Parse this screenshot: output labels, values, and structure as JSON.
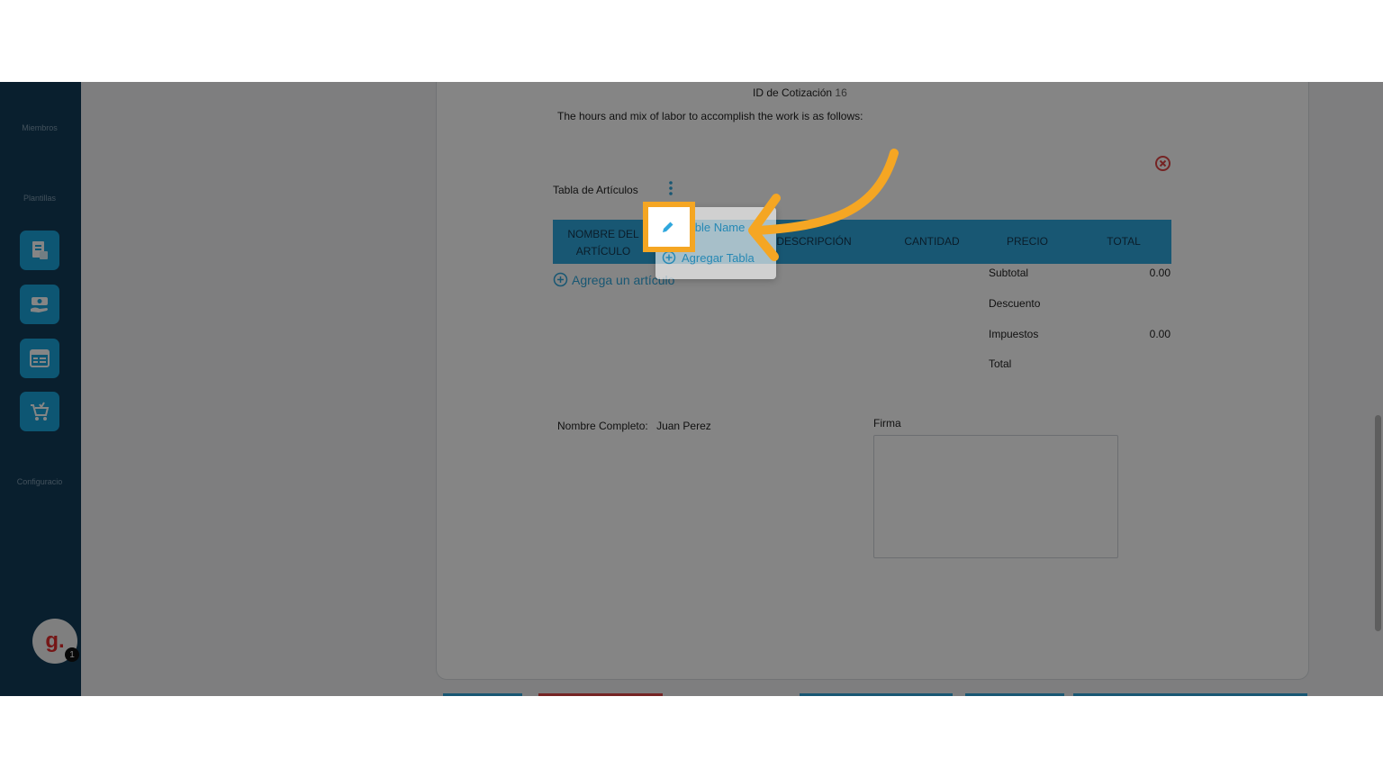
{
  "sidebar": {
    "sections": [
      "Miembros",
      "Plantillas",
      "Configuracio"
    ],
    "tiles": [
      "document-icon",
      "money-hand-icon",
      "spreadsheet-icon",
      "cart-icon"
    ],
    "avatar_letter": "g.",
    "avatar_badge": "1"
  },
  "quote": {
    "id_label": "ID de Cotización",
    "id_value": "16",
    "intro": "The hours and mix of labor to accomplish the work is as follows:",
    "table_title": "Tabla de Artículos",
    "columns": [
      "NOMBRE DEL ARTÍCULO",
      "DESCRIPCIÓN",
      "CANTIDAD",
      "PRECIO",
      "TOTAL"
    ],
    "add_item": "Agrega un artículo",
    "totals": [
      {
        "label": "Subtotal",
        "value": "0.00"
      },
      {
        "label": "Descuento",
        "value": ""
      },
      {
        "label": "Impuestos",
        "value": "0.00"
      },
      {
        "label": "Total",
        "value": ""
      }
    ],
    "full_name_label": "Nombre Completo:",
    "full_name_value": "Juan Perez",
    "signature_label": "Firma"
  },
  "context_menu": {
    "items": [
      {
        "label": "Table Name",
        "icon": "pencil-icon"
      },
      {
        "label": "Agregar Tabla",
        "icon": "plus-circle-icon"
      }
    ]
  },
  "colors": {
    "sidebar": "#133d59",
    "accent": "#2fa7dd",
    "callout": "#f5a623",
    "delete": "#e04545"
  }
}
